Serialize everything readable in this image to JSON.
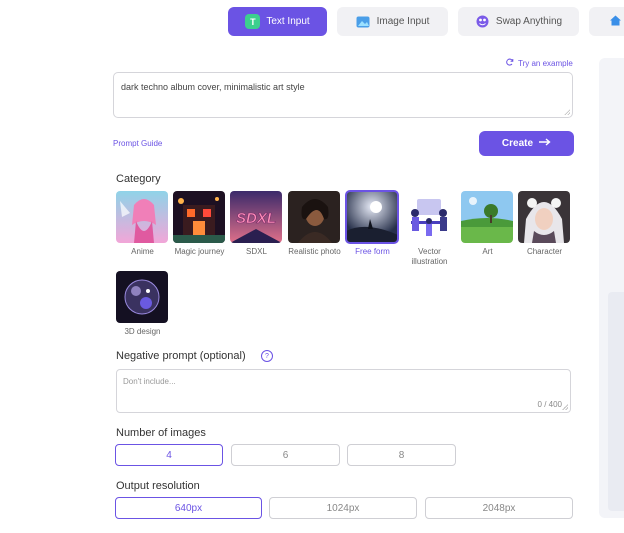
{
  "tabs": [
    {
      "label": "Text Input",
      "icon": "text-icon",
      "active": true
    },
    {
      "label": "Image Input",
      "icon": "image-icon",
      "active": false
    },
    {
      "label": "Swap Anything",
      "icon": "swap-icon",
      "active": false
    }
  ],
  "try_example": "Try an example",
  "prompt": {
    "value": "dark techno album cover, minimalistic art style"
  },
  "prompt_guide": "Prompt Guide",
  "create_label": "Create",
  "category": {
    "title": "Category",
    "items": [
      {
        "label": "Anime",
        "selected": false
      },
      {
        "label": "Magic journey",
        "selected": false
      },
      {
        "label": "SDXL",
        "selected": false
      },
      {
        "label": "Realistic photo",
        "selected": false
      },
      {
        "label": "Free form",
        "selected": true
      },
      {
        "label": "Vector illustration",
        "selected": false
      },
      {
        "label": "Art",
        "selected": false
      },
      {
        "label": "Character",
        "selected": false
      },
      {
        "label": "3D design",
        "selected": false
      }
    ],
    "sdxl_text": "SDXL"
  },
  "negative": {
    "title": "Negative prompt (optional)",
    "placeholder": "Don't include...",
    "counter": "0 / 400"
  },
  "num_images": {
    "title": "Number of images",
    "options": [
      "4",
      "6",
      "8"
    ],
    "selected": "4"
  },
  "resolution": {
    "title": "Output resolution",
    "options": [
      "640px",
      "1024px",
      "2048px"
    ],
    "selected": "640px"
  },
  "colors": {
    "accent": "#6b53e4"
  }
}
